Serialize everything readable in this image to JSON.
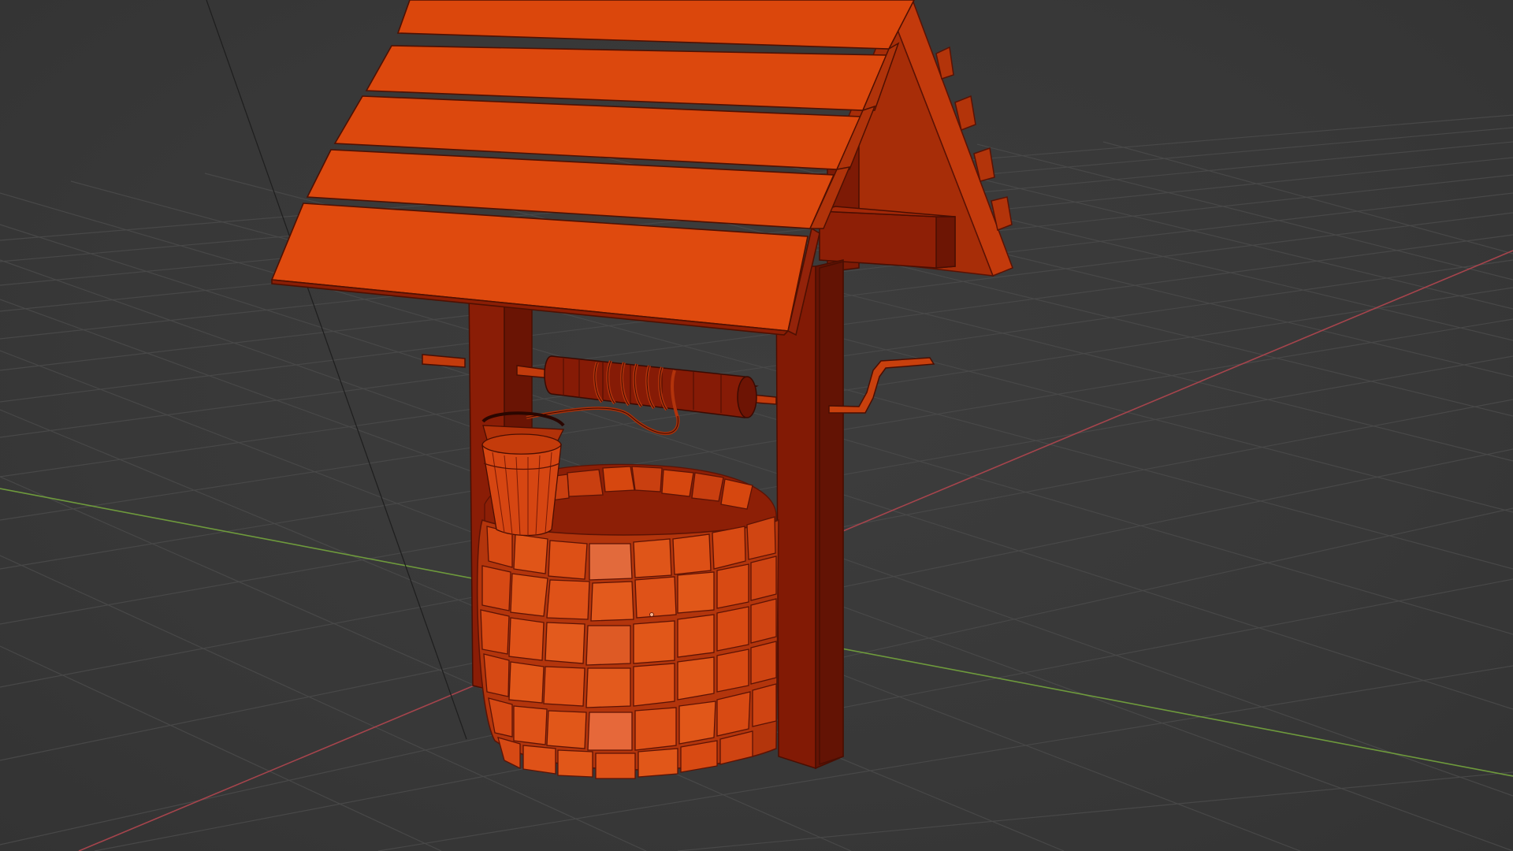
{
  "viewport": {
    "background": "#3a3a3a",
    "grid_color": "#4a4a4a",
    "x_axis_color": "#a5444c",
    "y_axis_color": "#6e9a3c",
    "model_color": "#d9480f",
    "model_dark": "#8f1d06",
    "selection": "whole-object-selected",
    "object": "wishing-well"
  }
}
